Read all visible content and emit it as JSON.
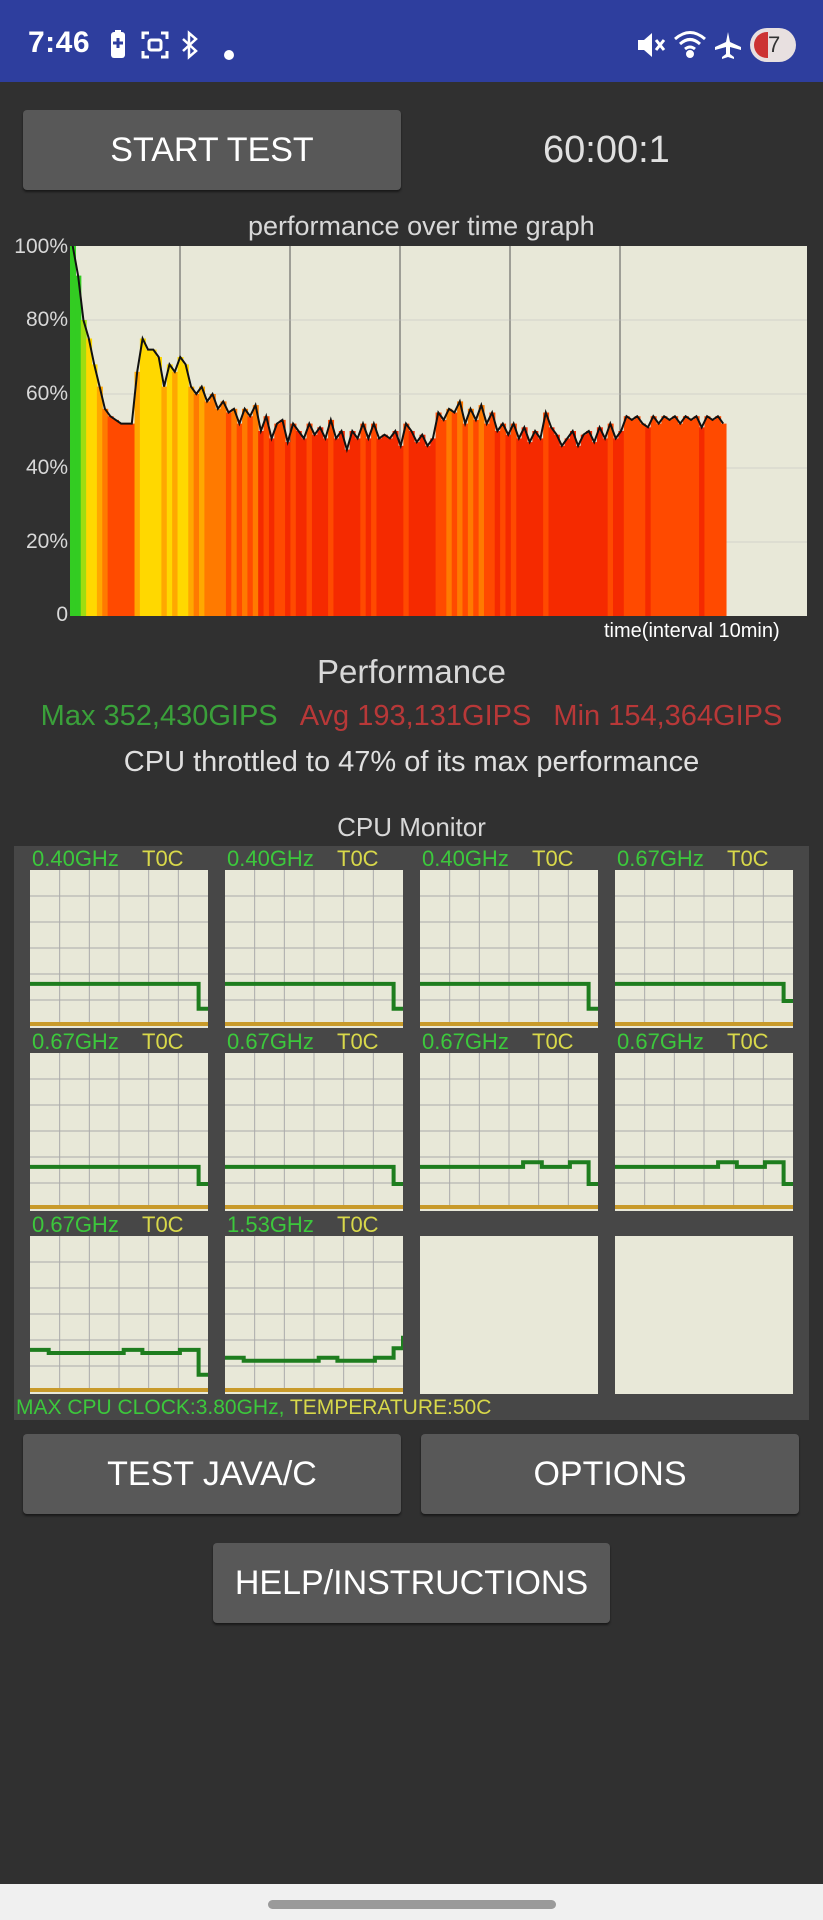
{
  "status_bar": {
    "time": "7:46",
    "badge_count": "7",
    "icons": [
      "battery-saver-icon",
      "screenshot-icon",
      "bluetooth-icon",
      "dot-icon",
      "mute-icon",
      "wifi-icon",
      "airplane-icon"
    ]
  },
  "controls": {
    "start_label": "START TEST",
    "timer": "60:00:1",
    "test_java_label": "TEST JAVA/C",
    "options_label": "OPTIONS",
    "help_label": "HELP/INSTRUCTIONS"
  },
  "graph": {
    "title": "performance over time graph",
    "x_label": "time(interval 10min)",
    "y_ticks": [
      "100%",
      "80%",
      "60%",
      "40%",
      "20%",
      "0"
    ]
  },
  "chart_data": {
    "type": "area",
    "title": "performance over time graph",
    "xlabel": "time(interval 10min)",
    "ylabel": "",
    "ylim": [
      0,
      100
    ],
    "grid": true,
    "x_end_fraction": 0.89,
    "values": [
      100,
      92,
      80,
      75,
      68,
      62,
      56,
      54,
      53,
      52,
      52,
      52,
      66,
      75,
      72,
      72,
      70,
      62,
      68,
      66,
      70,
      68,
      62,
      60,
      62,
      58,
      60,
      56,
      58,
      55,
      56,
      52,
      56,
      54,
      57,
      50,
      54,
      48,
      52,
      53,
      47,
      52,
      50,
      48,
      52,
      49,
      51,
      48,
      53,
      48,
      50,
      45,
      50,
      48,
      52,
      48,
      52,
      48,
      49,
      48,
      50,
      46,
      52,
      50,
      47,
      49,
      46,
      48,
      55,
      53,
      56,
      55,
      58,
      52,
      56,
      53,
      57,
      52,
      55,
      50,
      52,
      49,
      52,
      48,
      51,
      47,
      50,
      48,
      55,
      51,
      49,
      46,
      48,
      50,
      46,
      49,
      50,
      47,
      51,
      48,
      52,
      48,
      50,
      54,
      53,
      54,
      52,
      51,
      54,
      52,
      54,
      53,
      54,
      52,
      54,
      53,
      54,
      51,
      54,
      53,
      54,
      52
    ]
  },
  "performance": {
    "heading": "Performance",
    "max": "Max 352,430GIPS",
    "avg": "Avg 193,131GIPS",
    "min": "Min 154,364GIPS",
    "throttle_text": "CPU throttled to 47% of its max performance"
  },
  "cpu_monitor": {
    "title": "CPU Monitor",
    "cores": [
      {
        "freq": "0.40GHz",
        "temp": "T0C",
        "line": [
          0.27,
          0.27,
          0.27,
          0.27,
          0.27,
          0.27,
          0.27,
          0.27,
          0.27,
          0.27,
          0.27,
          0.27,
          0.27,
          0.27,
          0.27,
          0.27,
          0.27,
          0.27,
          0.11,
          0.11
        ]
      },
      {
        "freq": "0.40GHz",
        "temp": "T0C",
        "line": [
          0.27,
          0.27,
          0.27,
          0.27,
          0.27,
          0.27,
          0.27,
          0.27,
          0.27,
          0.27,
          0.27,
          0.27,
          0.27,
          0.27,
          0.27,
          0.27,
          0.27,
          0.27,
          0.11,
          0.11
        ]
      },
      {
        "freq": "0.40GHz",
        "temp": "T0C",
        "line": [
          0.27,
          0.27,
          0.27,
          0.27,
          0.27,
          0.27,
          0.27,
          0.27,
          0.27,
          0.27,
          0.27,
          0.27,
          0.27,
          0.27,
          0.27,
          0.27,
          0.27,
          0.27,
          0.11,
          0.11
        ]
      },
      {
        "freq": "0.67GHz",
        "temp": "T0C",
        "line": [
          0.27,
          0.27,
          0.27,
          0.27,
          0.27,
          0.27,
          0.27,
          0.27,
          0.27,
          0.27,
          0.27,
          0.27,
          0.27,
          0.27,
          0.27,
          0.27,
          0.27,
          0.27,
          0.16,
          0.16
        ]
      },
      {
        "freq": "0.67GHz",
        "temp": "T0C",
        "line": [
          0.27,
          0.27,
          0.27,
          0.27,
          0.27,
          0.27,
          0.27,
          0.27,
          0.27,
          0.27,
          0.27,
          0.27,
          0.27,
          0.27,
          0.27,
          0.27,
          0.27,
          0.27,
          0.16,
          0.16
        ]
      },
      {
        "freq": "0.67GHz",
        "temp": "T0C",
        "line": [
          0.27,
          0.27,
          0.27,
          0.27,
          0.27,
          0.27,
          0.27,
          0.27,
          0.27,
          0.27,
          0.27,
          0.27,
          0.27,
          0.27,
          0.27,
          0.27,
          0.27,
          0.27,
          0.16,
          0.16
        ]
      },
      {
        "freq": "0.67GHz",
        "temp": "T0C",
        "line": [
          0.27,
          0.27,
          0.27,
          0.27,
          0.27,
          0.27,
          0.27,
          0.27,
          0.27,
          0.27,
          0.27,
          0.3,
          0.3,
          0.27,
          0.27,
          0.27,
          0.3,
          0.3,
          0.16,
          0.16
        ]
      },
      {
        "freq": "0.67GHz",
        "temp": "T0C",
        "line": [
          0.27,
          0.27,
          0.27,
          0.27,
          0.27,
          0.27,
          0.27,
          0.27,
          0.27,
          0.27,
          0.27,
          0.3,
          0.3,
          0.27,
          0.27,
          0.27,
          0.3,
          0.3,
          0.16,
          0.16
        ]
      },
      {
        "freq": "0.67GHz",
        "temp": "T0C",
        "line": [
          0.27,
          0.27,
          0.25,
          0.25,
          0.25,
          0.25,
          0.25,
          0.25,
          0.25,
          0.25,
          0.27,
          0.27,
          0.25,
          0.25,
          0.25,
          0.25,
          0.27,
          0.27,
          0.11,
          0.11
        ]
      },
      {
        "freq": "1.53GHz",
        "temp": "T0C",
        "line": [
          0.22,
          0.22,
          0.2,
          0.2,
          0.2,
          0.2,
          0.2,
          0.2,
          0.2,
          0.2,
          0.22,
          0.22,
          0.2,
          0.2,
          0.2,
          0.2,
          0.22,
          0.22,
          0.28,
          0.36
        ]
      },
      null,
      null
    ],
    "footer_clock": "MAX CPU CLOCK:3.80GHz, ",
    "footer_temp": "TEMPERATURE:50C"
  }
}
